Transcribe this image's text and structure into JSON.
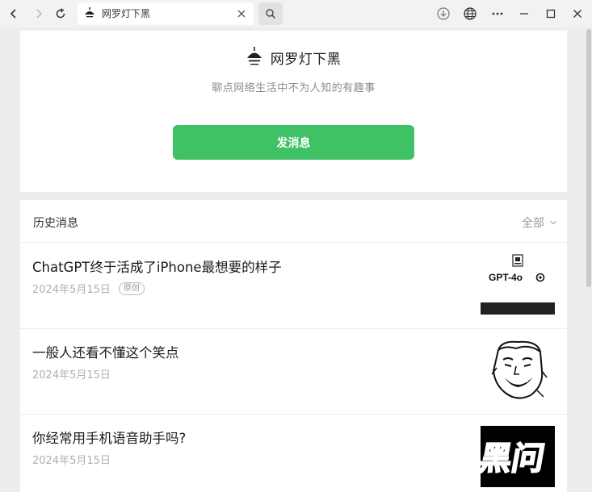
{
  "browser": {
    "tab_title": "网罗灯下黑"
  },
  "profile": {
    "name": "网罗灯下黑",
    "description": "聊点网络生活中不为人知的有趣事",
    "send_button": "发消息"
  },
  "history": {
    "title": "历史消息",
    "filter": "全部",
    "articles": [
      {
        "title": "ChatGPT终于活成了iPhone最想要的样子",
        "date": "2024年5月15日",
        "badge": "原创",
        "thumb_text": "GPT-4o"
      },
      {
        "title": "一般人还看不懂这个笑点",
        "date": "2024年5月15日"
      },
      {
        "title": "你经常用手机语音助手吗?",
        "date": "2024年5月15日",
        "thumb_text": "黑问"
      }
    ]
  },
  "colors": {
    "accent_green": "#3fc165",
    "background": "#ededed"
  }
}
